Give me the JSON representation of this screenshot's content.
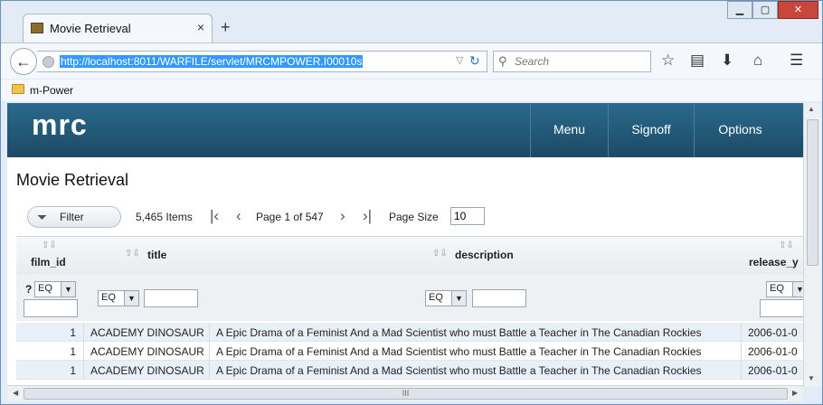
{
  "browser": {
    "tab_title": "Movie Retrieval",
    "tab_close": "×",
    "new_tab": "+",
    "window_controls": {
      "minimize": "▁",
      "maximize": "▢",
      "close": "✕"
    },
    "url": "http://localhost:8011/WARFILE/servlet/MRCMPOWER.I00010s",
    "search_placeholder": "Search",
    "bookmarks": [
      {
        "label": "m-Power"
      }
    ]
  },
  "app": {
    "logo": "mrc",
    "menu": [
      {
        "label": "Menu"
      },
      {
        "label": "Signoff"
      },
      {
        "label": "Options"
      }
    ],
    "page_title": "Movie Retrieval"
  },
  "toolbar": {
    "filter_label": "Filter",
    "item_count": "5,465 Items",
    "page_info": "Page 1 of 547",
    "page_size_label": "Page Size",
    "page_size_value": "10"
  },
  "grid": {
    "columns": [
      {
        "label": "film_id"
      },
      {
        "label": "title"
      },
      {
        "label": "description"
      },
      {
        "label": "release_y"
      }
    ],
    "filter_op": "EQ",
    "filter_help": "?",
    "rows": [
      {
        "film_id": "1",
        "title": "ACADEMY DINOSAUR",
        "description": "A Epic Drama of a Feminist And a Mad Scientist who must Battle a Teacher in The Canadian Rockies",
        "release": "2006-01-0"
      },
      {
        "film_id": "1",
        "title": "ACADEMY DINOSAUR",
        "description": "A Epic Drama of a Feminist And a Mad Scientist who must Battle a Teacher in The Canadian Rockies",
        "release": "2006-01-0"
      },
      {
        "film_id": "1",
        "title": "ACADEMY DINOSAUR",
        "description": "A Epic Drama of a Feminist And a Mad Scientist who must Battle a Teacher in The Canadian Rockies",
        "release": "2006-01-0"
      }
    ]
  },
  "scrollbar": {
    "grip": "III"
  },
  "colors": {
    "header_top": "#2a6a8e",
    "header_bottom": "#1c4a64",
    "row_alt": "#eaf0f7",
    "selection": "#3399ff"
  }
}
